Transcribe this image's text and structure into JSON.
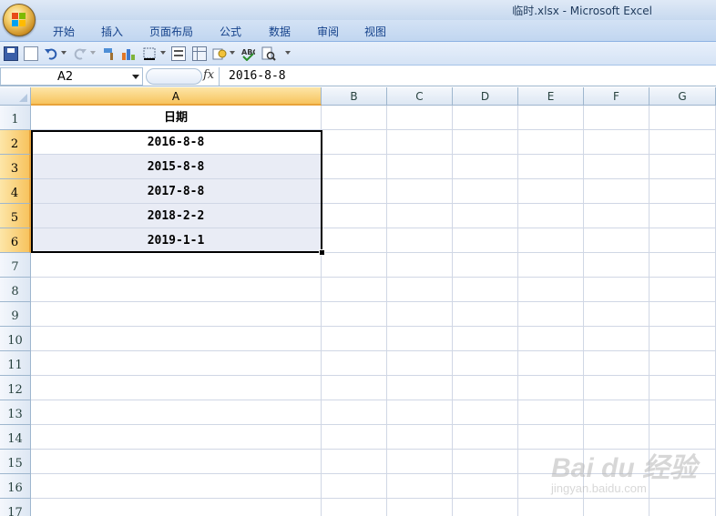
{
  "window": {
    "title": "临时.xlsx - Microsoft Excel"
  },
  "ribbon": {
    "tabs": [
      {
        "label": "开始"
      },
      {
        "label": "插入"
      },
      {
        "label": "页面布局"
      },
      {
        "label": "公式"
      },
      {
        "label": "数据"
      },
      {
        "label": "审阅"
      },
      {
        "label": "视图"
      }
    ]
  },
  "quick_access": {
    "icons": [
      "save-icon",
      "new-document-icon",
      "undo-icon",
      "redo-icon",
      "format-painter-icon",
      "chart-icon",
      "border-icon",
      "form-icon",
      "pivot-icon",
      "print-preview-settings-icon",
      "spell-check-icon",
      "print-preview-icon",
      "customize-toolbar-icon"
    ]
  },
  "formula_bar": {
    "name_box": "A2",
    "fx_label": "fx",
    "formula": "2016-8-8"
  },
  "sheet": {
    "columns": [
      "A",
      "B",
      "C",
      "D",
      "E",
      "F",
      "G"
    ],
    "selected_column": "A",
    "rows": [
      "1",
      "2",
      "3",
      "4",
      "5",
      "6",
      "7",
      "8",
      "9",
      "10",
      "11",
      "12",
      "13",
      "14",
      "15",
      "16",
      "17"
    ],
    "selected_rows": [
      "2",
      "3",
      "4",
      "5",
      "6"
    ],
    "cells": {
      "A1": "日期",
      "A2": "2016-8-8",
      "A3": "2015-8-8",
      "A4": "2017-8-8",
      "A5": "2018-2-2",
      "A6": "2019-1-1"
    }
  },
  "watermark": {
    "logo_text": "Bai du 经验",
    "url": "jingyan.baidu.com"
  }
}
